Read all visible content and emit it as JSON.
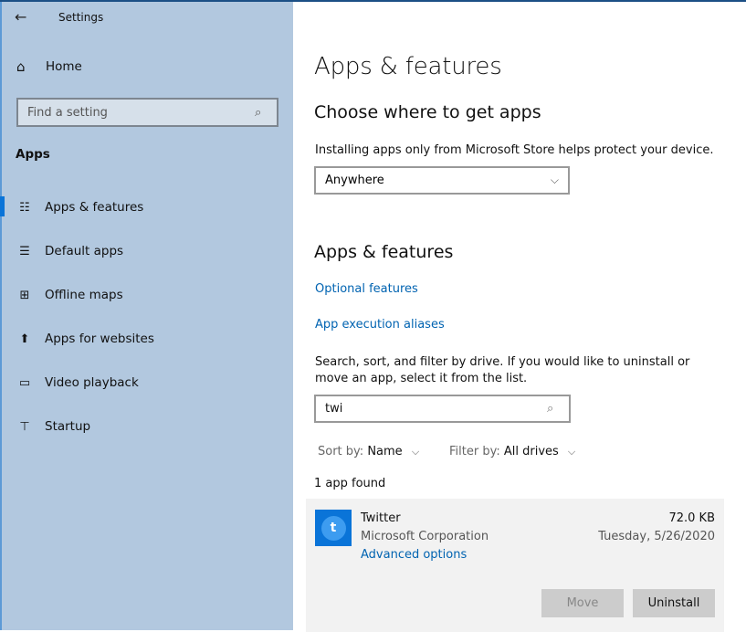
{
  "window": {
    "title": "Settings",
    "back_icon": "←"
  },
  "sidebar": {
    "home_label": "Home",
    "home_icon": "⌂",
    "search_placeholder": "Find a setting",
    "search_icon": "⌕",
    "section_label": "Apps",
    "items": [
      {
        "label": "Apps & features",
        "icon": "☷",
        "active": true
      },
      {
        "label": "Default apps",
        "icon": "☰",
        "active": false
      },
      {
        "label": "Offline maps",
        "icon": "⊞",
        "active": false
      },
      {
        "label": "Apps for websites",
        "icon": "⬆",
        "active": false
      },
      {
        "label": "Video playback",
        "icon": "▭",
        "active": false
      },
      {
        "label": "Startup",
        "icon": "⊤",
        "active": false
      }
    ]
  },
  "main": {
    "page_title": "Apps & features",
    "choose_heading": "Choose where to get apps",
    "choose_desc": "Installing apps only from Microsoft Store helps protect your device.",
    "source_dropdown": {
      "value": "Anywhere",
      "chevron": "⌵"
    },
    "features_heading": "Apps & features",
    "links": {
      "optional_features": "Optional features",
      "execution_aliases": "App execution aliases"
    },
    "search_desc": "Search, sort, and filter by drive. If you would like to uninstall or move an app, select it from the list.",
    "app_search": {
      "value": "twi",
      "icon": "⌕"
    },
    "sort": {
      "key": "Sort by:",
      "value": "Name",
      "chevron": "⌵"
    },
    "filter": {
      "key": "Filter by:",
      "value": "All drives",
      "chevron": "⌵"
    },
    "found_text": "1 app found",
    "apps": [
      {
        "name": "Twitter",
        "publisher": "Microsoft Corporation",
        "advanced_label": "Advanced options",
        "size": "72.0 KB",
        "date": "Tuesday, 5/26/2020",
        "icon_glyph": "t",
        "move_label": "Move",
        "uninstall_label": "Uninstall"
      }
    ]
  },
  "colors": {
    "accent": "#0a74d8",
    "link": "#0063b1",
    "sidebar_bg": "#b2c8df"
  }
}
